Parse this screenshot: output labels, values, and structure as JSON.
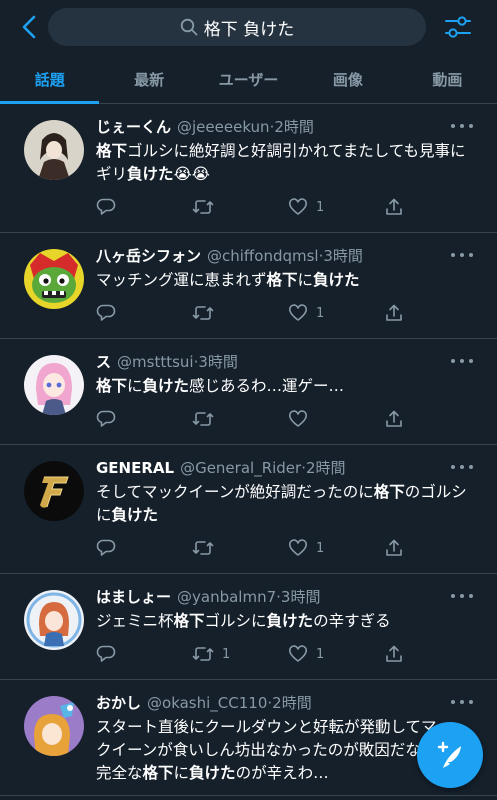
{
  "search": {
    "query": "格下 負けた"
  },
  "tabs": [
    {
      "label": "話題"
    },
    {
      "label": "最新"
    },
    {
      "label": "ユーザー"
    },
    {
      "label": "画像"
    },
    {
      "label": "動画"
    }
  ],
  "tweets": [
    {
      "name": "じぇーくん",
      "handle": "@jeeeeekun",
      "time": "2時間",
      "text_parts": [
        "",
        "格下",
        "ゴルシに絶好調と好調引かれてまたしても見事にギリ",
        "負けた",
        "😭😭"
      ],
      "reply_count": "",
      "retweet_count": "",
      "like_count": "1"
    },
    {
      "name": "八ヶ岳シフォン",
      "handle": "@chiffondqmsl",
      "time": "3時間",
      "text_parts": [
        "マッチング運に恵まれず",
        "格下",
        "に",
        "負けた",
        ""
      ],
      "reply_count": "",
      "retweet_count": "",
      "like_count": "1"
    },
    {
      "name": "ス",
      "handle": "@mstttsui",
      "time": "3時間",
      "text_parts": [
        "",
        "格下",
        "に",
        "負けた",
        "感じあるわ…運ゲー…"
      ],
      "reply_count": "",
      "retweet_count": "",
      "like_count": ""
    },
    {
      "name": "GENERAL",
      "handle": "@General_Rider",
      "time": "2時間",
      "text_parts": [
        "そしてマックイーンが絶好調だったのに",
        "格下",
        "のゴルシに",
        "負けた",
        ""
      ],
      "reply_count": "",
      "retweet_count": "",
      "like_count": "1"
    },
    {
      "name": "はましょー",
      "handle": "@yanbalmn7",
      "time": "3時間",
      "text_parts": [
        "ジェミニ杯",
        "格下",
        "ゴルシに",
        "負けた",
        "の辛すぎる"
      ],
      "reply_count": "",
      "retweet_count": "1",
      "like_count": "1"
    },
    {
      "name": "おかし",
      "handle": "@okashi_CC110",
      "time": "2時間",
      "text_parts": [
        "スタート直後にクールダウンと好転が発動してマックイーンが食いしん坊出なかったのが敗因だなぁ\n完全な",
        "格下",
        "に",
        "負けた",
        "のが辛えわ…"
      ],
      "reply_count": "",
      "retweet_count": "",
      "like_count": ""
    }
  ],
  "colors": {
    "background": "#15202b",
    "accent": "#1da1f2",
    "muted": "#8899a6",
    "divider": "#38444d"
  }
}
